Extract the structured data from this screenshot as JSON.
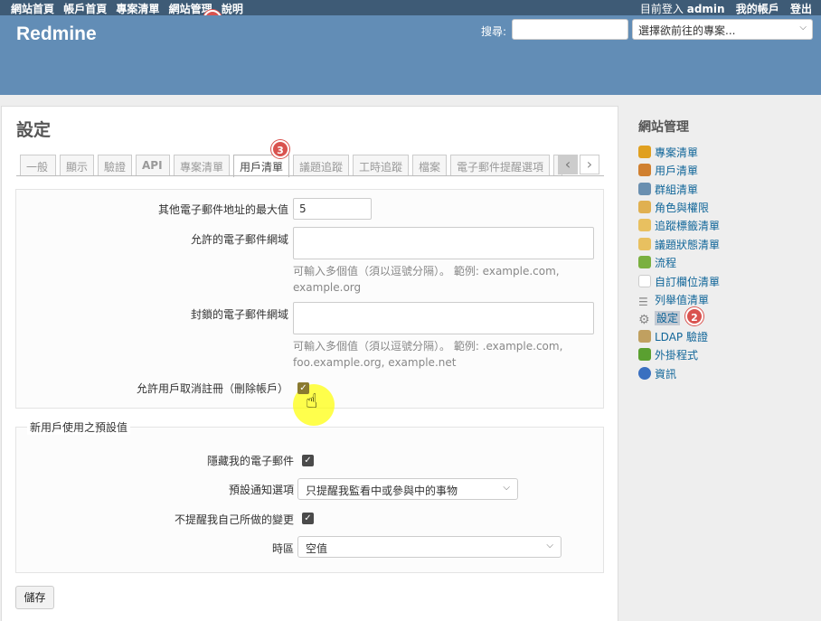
{
  "top_menu": {
    "left": [
      "網站首頁",
      "帳戶首頁",
      "專案清單",
      "網站管理",
      "說明"
    ],
    "logged_in_prefix": "目前登入",
    "user": "admin",
    "my_account": "我的帳戶",
    "logout": "登出"
  },
  "header": {
    "title": "Redmine",
    "search_label": "搜尋:",
    "project_select": "選擇欲前往的專案..."
  },
  "badges": [
    "1",
    "2",
    "3"
  ],
  "page": {
    "title": "設定",
    "tabs": [
      "一般",
      "顯示",
      "驗證",
      "API",
      "專案清單",
      "用戶清單",
      "議題追蹤",
      "工時追蹤",
      "檔案",
      "電子郵件提醒選項"
    ],
    "selected_tab": "用戶清單"
  },
  "form": {
    "max_emails_label": "其他電子郵件地址的最大值",
    "max_emails_value": "5",
    "allowed_domains_label": "允許的電子郵件網域",
    "allowed_hint_1": "可輸入多個值（須以逗號分隔）。 範例: example.com,",
    "allowed_hint_2": "example.org",
    "denied_domains_label": "封鎖的電子郵件網域",
    "denied_hint_1": "可輸入多個值（須以逗號分隔）。 範例: .example.com,",
    "denied_hint_2": "foo.example.org, example.net",
    "unsubscribe_label": "允許用戶取消註冊（刪除帳戶）"
  },
  "defaults": {
    "legend": "新用戶使用之預設值",
    "hide_email_label": "隱藏我的電子郵件",
    "notify_label": "預設通知選項",
    "notify_value": "只提醒我監看中或參與中的事物",
    "no_self_notify_label": "不提醒我自己所做的變更",
    "timezone_label": "時區",
    "timezone_value": "空值"
  },
  "save_label": "儲存",
  "sidebar": {
    "title": "網站管理",
    "items": [
      {
        "label": "專案清單",
        "icon": "projects-icon",
        "color": "#e0a020"
      },
      {
        "label": "用戶清單",
        "icon": "user-icon",
        "color": "#d08030"
      },
      {
        "label": "群組清單",
        "icon": "group-icon",
        "color": "#6a8fb0"
      },
      {
        "label": "角色與權限",
        "icon": "roles-icon",
        "color": "#e0b050"
      },
      {
        "label": "追蹤標籤清單",
        "icon": "tracker-icon",
        "color": "#e8c060"
      },
      {
        "label": "議題狀態清單",
        "icon": "status-icon",
        "color": "#e8c060"
      },
      {
        "label": "流程",
        "icon": "workflow-icon",
        "color": "#7ab040"
      },
      {
        "label": "自訂欄位清單",
        "icon": "custom-field-icon",
        "color": "#dddddd"
      },
      {
        "label": "列舉值清單",
        "icon": "list-icon",
        "color": "#888888"
      },
      {
        "label": "設定",
        "icon": "gear-icon",
        "color": "#999999"
      },
      {
        "label": "LDAP 驗證",
        "icon": "ldap-icon",
        "color": "#c0a060"
      },
      {
        "label": "外掛程式",
        "icon": "plugin-icon",
        "color": "#5aa030"
      },
      {
        "label": "資訊",
        "icon": "info-icon",
        "color": "#3a70c0"
      }
    ]
  }
}
